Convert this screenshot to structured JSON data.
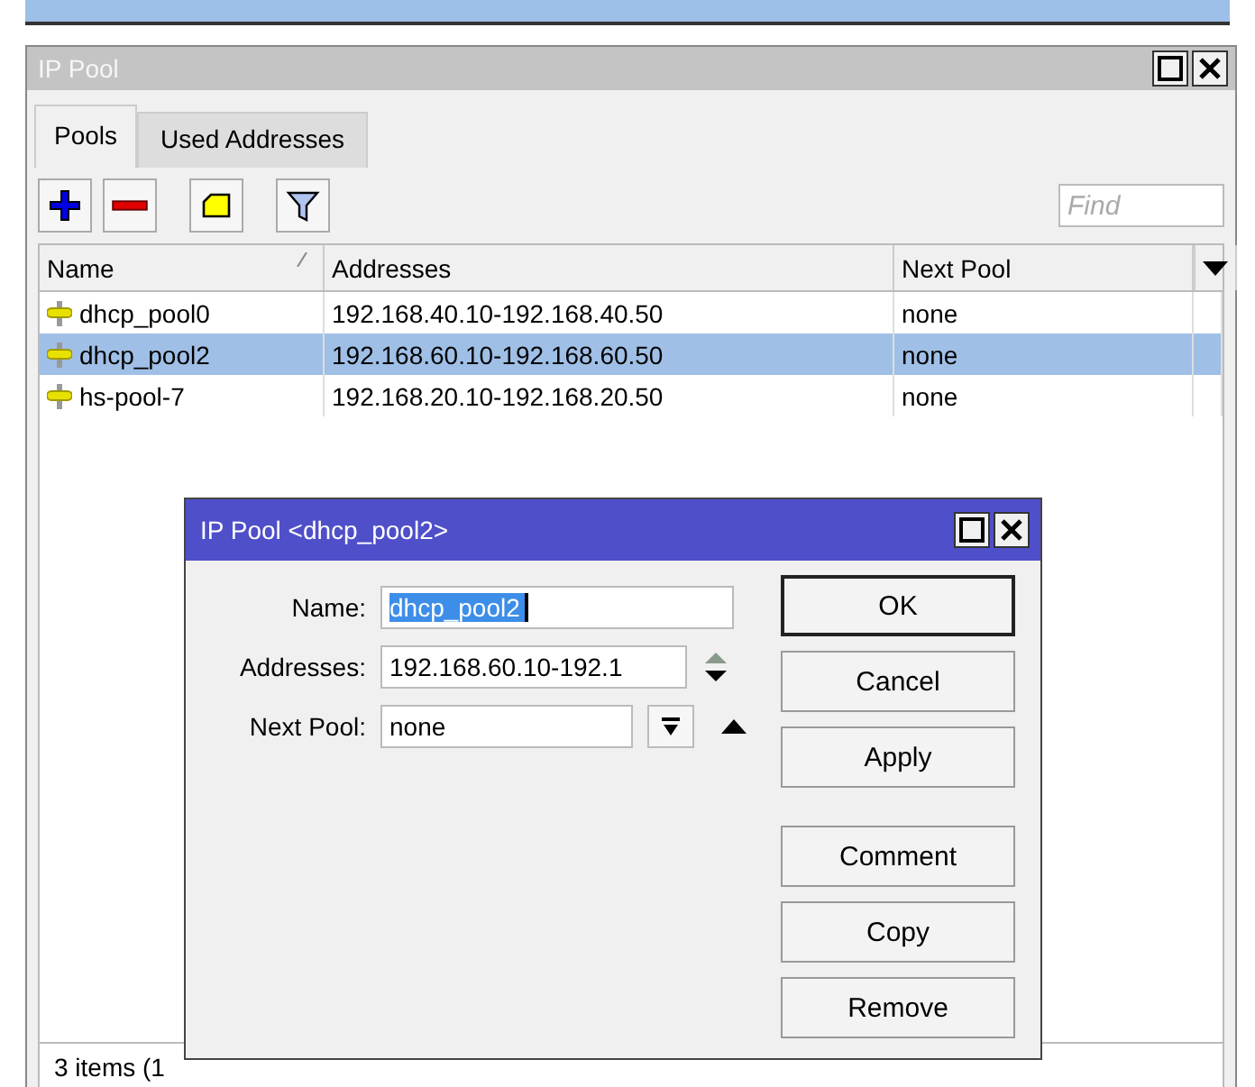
{
  "window": {
    "title": "IP Pool"
  },
  "tabs": [
    {
      "label": "Pools",
      "selected": true
    },
    {
      "label": "Used Addresses",
      "selected": false
    }
  ],
  "toolbar": {
    "buttons": [
      {
        "kind": "add"
      },
      {
        "kind": "remove"
      },
      {
        "kind": "comment"
      },
      {
        "kind": "filter"
      }
    ],
    "search": {
      "placeholder": "Find"
    }
  },
  "table": {
    "columns": [
      {
        "label": "Name",
        "sorted": true
      },
      {
        "label": "Addresses",
        "sorted": false
      },
      {
        "label": "Next Pool",
        "sorted": false
      }
    ],
    "rows": [
      {
        "name": "dhcp_pool0",
        "addresses": "192.168.40.10-192.168.40.50",
        "next_pool": "none",
        "selected": false
      },
      {
        "name": "dhcp_pool2",
        "addresses": "192.168.60.10-192.168.60.50",
        "next_pool": "none",
        "selected": true
      },
      {
        "name": "hs-pool-7",
        "addresses": "192.168.20.10-192.168.20.50",
        "next_pool": "none",
        "selected": false
      }
    ]
  },
  "status_bar": "3 items (1",
  "dialog": {
    "title": "IP Pool <dhcp_pool2>",
    "fields": [
      {
        "kind": "text",
        "label": "Name:",
        "value": "dhcp_pool2",
        "text_selected": true
      },
      {
        "kind": "range",
        "label": "Addresses:",
        "value": "192.168.60.10-192.1",
        "text_selected": false
      },
      {
        "kind": "dropdown",
        "label": "Next Pool:",
        "value": "none",
        "text_selected": false
      }
    ],
    "buttons": [
      {
        "label": "OK",
        "default": true
      },
      {
        "label": "Cancel",
        "default": false
      },
      {
        "label": "Apply",
        "default": false
      }
    ],
    "extra_buttons": [
      {
        "label": "Comment",
        "default": false
      },
      {
        "label": "Copy",
        "default": false
      },
      {
        "label": "Remove",
        "default": false
      }
    ]
  }
}
